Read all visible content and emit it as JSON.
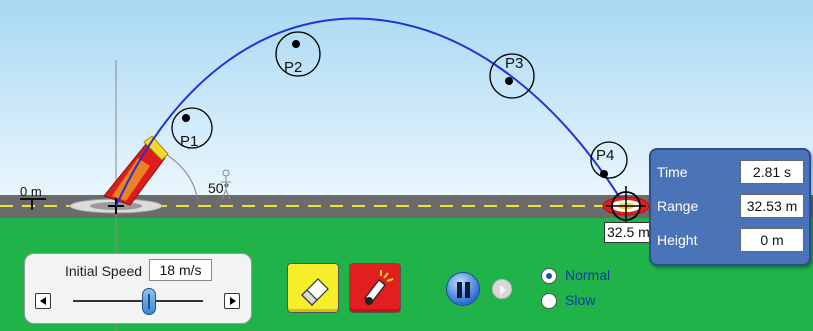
{
  "launch": {
    "angle_label": "50°",
    "distance_marker": "0 m"
  },
  "points": {
    "p1": "P1",
    "p2": "P2",
    "p3": "P3",
    "p4": "P4"
  },
  "landing": {
    "range_tag": "32.5 m"
  },
  "info_panel": {
    "time": {
      "label": "Time",
      "value": "2.81 s"
    },
    "range": {
      "label": "Range",
      "value": "32.53 m"
    },
    "height": {
      "label": "Height",
      "value": "0 m"
    }
  },
  "controls": {
    "initial_speed_label": "Initial Speed",
    "initial_speed_value": "18 m/s",
    "speed_mode": {
      "options": [
        "Normal",
        "Slow"
      ],
      "selected": "Normal"
    }
  },
  "colors": {
    "sky": "#cfe9f8",
    "grass": "#1fb34a",
    "road": "#6b6b6b",
    "trajectory": "#1f33d6",
    "panel": "#4b73b8"
  },
  "icons": [
    "eraser-icon",
    "cannon-icon",
    "pause-icon",
    "step-icon",
    "target-icon",
    "crosshair-icon"
  ]
}
